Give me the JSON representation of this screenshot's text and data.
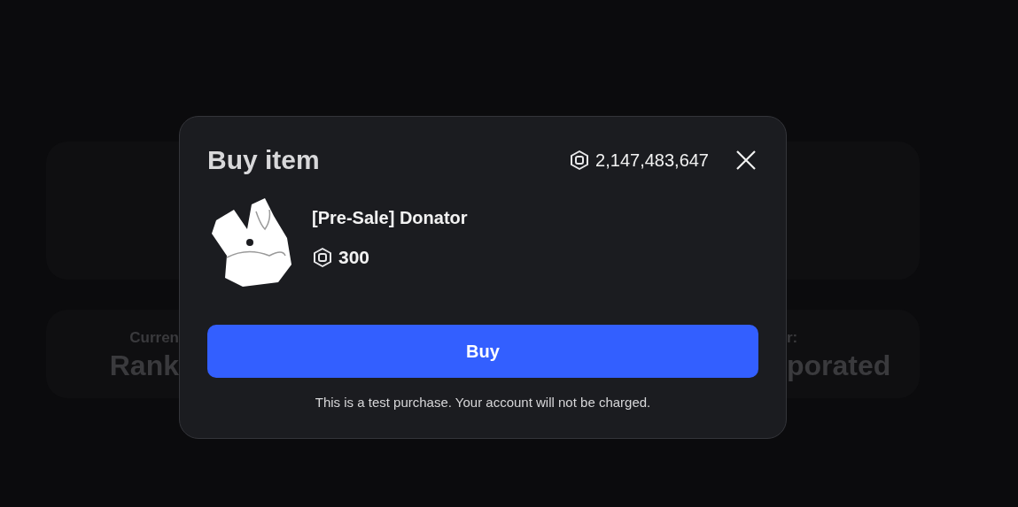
{
  "background": {
    "cards": [
      {
        "kind": "blank"
      },
      {
        "kind": "stats",
        "left_label": "Curren",
        "left_value": "Rank",
        "right_label": "r:",
        "right_value": "porated"
      }
    ]
  },
  "dialog": {
    "title": "Buy item",
    "balance": "2,147,483,647",
    "item": {
      "name": "[Pre-Sale] Donator",
      "price": "300"
    },
    "buy_button": "Buy",
    "note": "This is a test purchase. Your account will not be charged."
  }
}
